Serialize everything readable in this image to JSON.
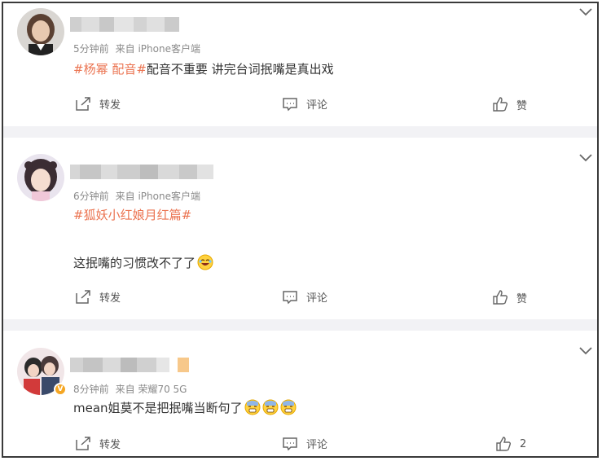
{
  "colors": {
    "tag": "#eb7350",
    "meta": "#8a8a8a",
    "separator": "#f2f2f5",
    "badge": "#f5a623"
  },
  "comments": [
    {
      "meta": {
        "time": "5分钟前",
        "source": "来自 iPhone客户端"
      },
      "text": {
        "tag1": "#杨幂 配音#",
        "rest": "配音不重要 讲完台词抿嘴是真出戏"
      },
      "actions": {
        "repost": "转发",
        "comment": "评论",
        "like": "赞"
      }
    },
    {
      "meta": {
        "time": "6分钟前",
        "source": "来自 iPhone客户端"
      },
      "text": {
        "tag1": "#狐妖小红娘月红篇#",
        "line2": "这抿嘴的习惯改不了了"
      },
      "actions": {
        "repost": "转发",
        "comment": "评论",
        "like": "赞"
      }
    },
    {
      "meta": {
        "time": "8分钟前",
        "source": "来自 荣耀70 5G"
      },
      "text": {
        "line1": "mean姐莫不是把抿嘴当断句了"
      },
      "badge": "V",
      "actions": {
        "repost": "转发",
        "comment": "评论",
        "like": "2"
      }
    }
  ]
}
